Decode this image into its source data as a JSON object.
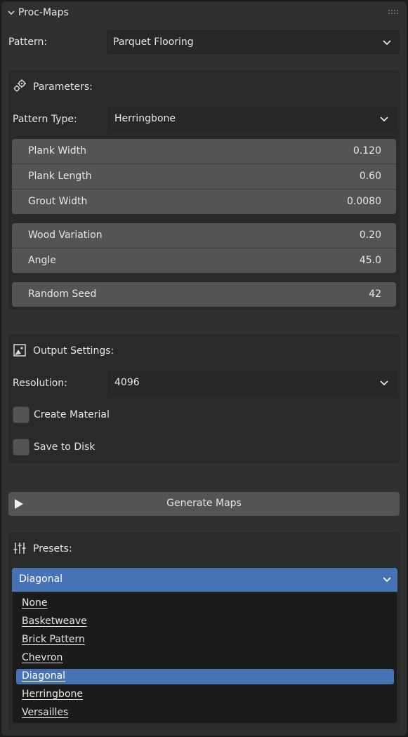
{
  "panel": {
    "title": "Proc-Maps"
  },
  "pattern": {
    "label": "Pattern:",
    "value": "Parquet Flooring"
  },
  "parameters": {
    "heading": "Parameters:",
    "pattern_type_label": "Pattern Type:",
    "pattern_type_value": "Herringbone",
    "group1": [
      {
        "label": "Plank Width",
        "value": "0.120"
      },
      {
        "label": "Plank Length",
        "value": "0.60"
      },
      {
        "label": "Grout Width",
        "value": "0.0080"
      }
    ],
    "group2": [
      {
        "label": "Wood Variation",
        "value": "0.20"
      },
      {
        "label": "Angle",
        "value": "45.0"
      }
    ],
    "group3": [
      {
        "label": "Random Seed",
        "value": "42"
      }
    ]
  },
  "output": {
    "heading": "Output Settings:",
    "resolution_label": "Resolution:",
    "resolution_value": "4096",
    "create_material_label": "Create Material",
    "create_material_checked": false,
    "save_to_disk_label": "Save to Disk",
    "save_to_disk_checked": false
  },
  "generate": {
    "label": "Generate Maps"
  },
  "presets": {
    "heading": "Presets:",
    "selected": "Diagonal",
    "options": [
      "None",
      "Basketweave",
      "Brick Pattern",
      "Chevron",
      "Diagonal",
      "Herringbone",
      "Versailles"
    ]
  },
  "colors": {
    "accent": "#4772b3",
    "panel_bg": "#303030",
    "field_bg": "#545454"
  }
}
